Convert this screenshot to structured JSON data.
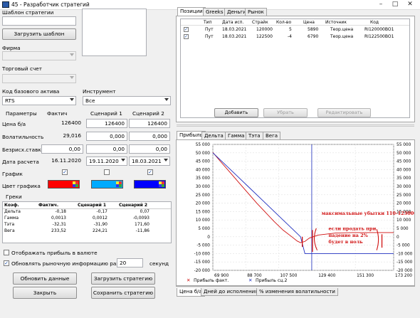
{
  "window": {
    "title": "45 - Разработчик стратегий"
  },
  "left": {
    "template_label": "Шаблон стратегии",
    "load_template_btn": "Загрузить шаблон",
    "firm_label": "Фирма",
    "account_label": "Торговый счет",
    "base_asset_label": "Код базового актива",
    "base_asset_value": "RTS",
    "instrument_label": "Инструмент",
    "instrument_value": "Все",
    "params_header": "Параметры",
    "col_fact": "Фактич",
    "col_s1": "Сценарий 1",
    "col_s2": "Сценарий 2",
    "rows": [
      {
        "label": "Цена б/а",
        "fact": "126400",
        "s1": "126400",
        "s2": "126400"
      },
      {
        "label": "Волатильность",
        "fact": "29,016",
        "s1": "0,000",
        "s2": "0,000"
      },
      {
        "label": "Безрисх.ставка",
        "fact": "0,00",
        "s1": "0,00",
        "s2": "0,00"
      },
      {
        "label": "Дата расчета",
        "fact": "16.11.2020",
        "s1": "19.11.2020",
        "s2": "18.03.2021"
      }
    ],
    "graph_label": "График",
    "color_label": "Цвет графика",
    "colors": {
      "fact": "#ff0000",
      "s1": "#00aaff",
      "s2": "#0000ff"
    },
    "greeks_label": "Греки",
    "greeks_headers": [
      "Коэф.",
      "Фактич.",
      "Сценарий 1",
      "Сценарий 2"
    ],
    "greeks": [
      [
        "Дельта",
        "-0,18",
        "-0,17",
        "0,07"
      ],
      [
        "Гамма",
        "0,0013",
        "0,0012",
        "-0,0093"
      ],
      [
        "Тэта",
        "-32,31",
        "-31,90",
        "171,60"
      ],
      [
        "Вега",
        "233,52",
        "224,21",
        "-11,86"
      ]
    ],
    "show_currency_label": "Отображать прибыль в валюте",
    "refresh_label_a": "Обновлять рыночную информацию раз в",
    "refresh_value": "20",
    "refresh_label_b": "секунд",
    "btn_update": "Обновить данные",
    "btn_load_strategy": "Загрузить стратегию",
    "btn_close": "Закрыть",
    "btn_save_strategy": "Сохранить стратегию"
  },
  "top_right": {
    "tabs": [
      "Позиции",
      "Greeks",
      "Деньги",
      "Рынок"
    ],
    "headers": [
      "Тип",
      "Дата исп.",
      "Страйк",
      "Кол-во",
      "Цена",
      "Источник",
      "Код"
    ],
    "rows": [
      [
        "Пут",
        "18.03.2021",
        "120000",
        "5",
        "5890",
        "Теор.цена",
        "RI120000BO1"
      ],
      [
        "Пут",
        "18.03.2021",
        "122500",
        "-4",
        "6790",
        "Теор.цена",
        "RI122500BO1"
      ]
    ],
    "btn_add": "Добавить",
    "btn_remove": "Убрать",
    "btn_edit": "Редактировать"
  },
  "chart_tabs": [
    "Прибыль",
    "Дельта",
    "Гамма",
    "Тэта",
    "Вега"
  ],
  "bottom_tabs": [
    "Цена б/а",
    "Дней до исполнения",
    "% изменения волатильности"
  ],
  "chart_data": {
    "type": "line",
    "y_ticks": [
      "55 000",
      "50 000",
      "45 000",
      "40 000",
      "35 000",
      "30 000",
      "25 000",
      "20 000",
      "15 000",
      "10 000",
      "5 000",
      "0",
      "-5 000",
      "-10 000",
      "-15 000",
      "-20 000"
    ],
    "y_ticks_right": [
      "55 000",
      "50 000",
      "45 000",
      "40 000",
      "35 000",
      "30 000",
      "25 000",
      "20 000",
      "15 000",
      "10 000",
      "5 000",
      "0",
      "-5 000",
      "-10 000",
      "-15 000",
      "-20 000"
    ],
    "x_ticks": [
      "69 900",
      "88 700",
      "107 500",
      "129 400",
      "151 300",
      "173 200"
    ],
    "ylim": [
      -20000,
      55000
    ],
    "series": [
      {
        "name": "Прибыль факт.",
        "color": "#d01010",
        "x": [
          69900,
          75000,
          80000,
          85000,
          90000,
          95000,
          100000,
          105000,
          110000,
          115000,
          118000,
          120000,
          122500,
          125000,
          130000,
          140000,
          150000,
          160000,
          170000,
          173200
        ],
        "y": [
          50200,
          44000,
          38000,
          32000,
          26000,
          20000,
          14500,
          9000,
          4000,
          0,
          -2500,
          -3500,
          -2800,
          -800,
          1000,
          2200,
          2500,
          2500,
          2500,
          2500
        ]
      },
      {
        "name": "Прибыль сц.2",
        "color": "#2030c0",
        "x": [
          69900,
          80000,
          90000,
          100000,
          110000,
          118000,
          120000,
          122500,
          125000,
          130000,
          150000,
          173200
        ],
        "y": [
          50000,
          40000,
          30000,
          20000,
          10000,
          2000,
          0,
          -10000,
          -10000,
          -10000,
          -10000,
          -10000
        ]
      }
    ],
    "current_price_line": 126400,
    "annotations": [
      {
        "text": "максимальные убытки 110-123000",
        "x": 132000,
        "y": 13000
      },
      {
        "text": "если продать при",
        "x": 136000,
        "y": 4000
      },
      {
        "text": "падение на 2%",
        "x": 136000,
        "y": 0
      },
      {
        "text": "будет в ноль",
        "x": 136000,
        "y": -4000
      }
    ]
  }
}
